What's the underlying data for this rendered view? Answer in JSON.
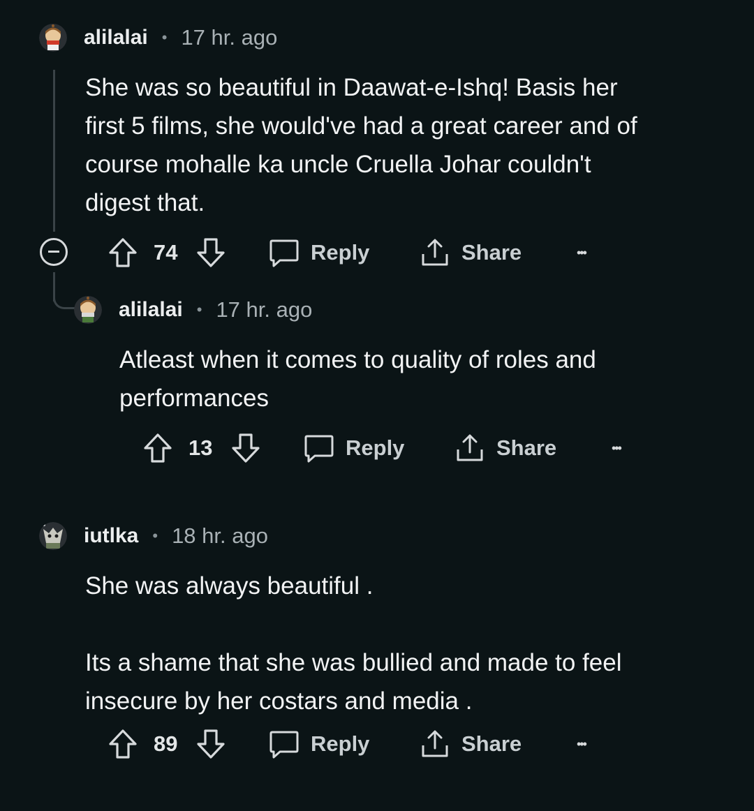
{
  "comments": [
    {
      "user": "alilalai",
      "time": "17 hr. ago",
      "body": "She was so beautiful in Daawat-e-Ishq! Basis her\nfirst 5 films, she would've had a great career and of\ncourse mohalle ka uncle Cruella Johar couldn't\ndigest that.",
      "votes": "74",
      "reply_label": "Reply",
      "share_label": "Share",
      "more_label": "•••"
    },
    {
      "user": "alilalai",
      "time": "17 hr. ago",
      "body": "Atleast when it comes to quality of roles and\nperformances",
      "votes": "13",
      "reply_label": "Reply",
      "share_label": "Share",
      "more_label": "•••"
    },
    {
      "user": "iutlka",
      "time": "18 hr. ago",
      "body": "She was always beautiful .\n\nIts a shame that she was bullied and made to feel\ninsecure by her costars and media .",
      "votes": "89",
      "reply_label": "Reply",
      "share_label": "Share",
      "more_label": "•••"
    }
  ],
  "separator": "•",
  "icons": {
    "collapse": "collapse-circle-minus-icon",
    "upvote": "upvote-arrow-icon",
    "downvote": "downvote-arrow-icon",
    "reply": "comment-bubble-icon",
    "share": "share-upload-icon",
    "more": "more-dots-icon"
  },
  "colors": {
    "background": "#0b1416",
    "text": "#f2f3f4",
    "muted": "#a9b1b5",
    "thread_line": "#3a4347"
  }
}
